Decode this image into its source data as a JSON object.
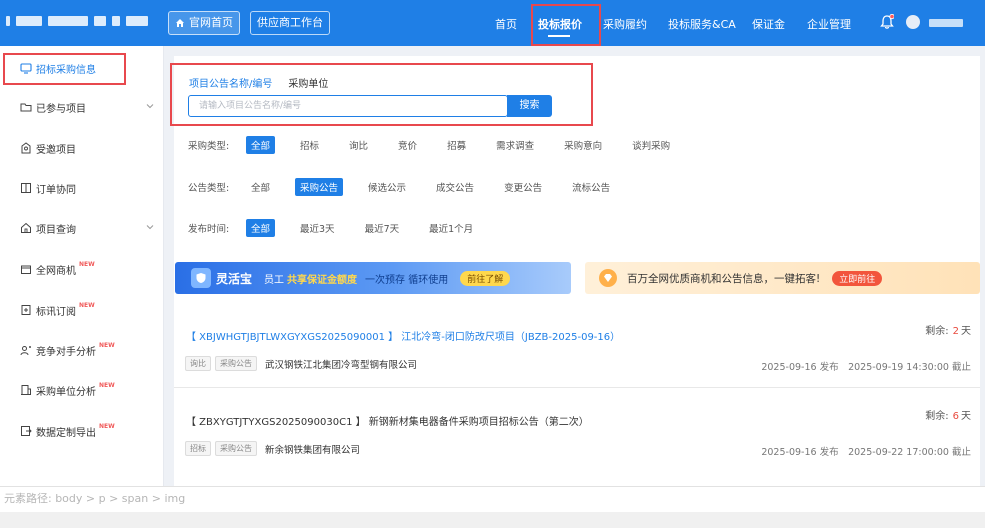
{
  "header": {
    "home_label": "官网首页",
    "supplier_label": "供应商工作台",
    "nav": [
      {
        "label": "首页"
      },
      {
        "label": "投标报价"
      },
      {
        "label": "采购履约"
      },
      {
        "label": "投标服务&CA"
      },
      {
        "label": "保证金"
      },
      {
        "label": "企业管理"
      }
    ],
    "accent_color": "#1f7fe6",
    "highlight_color": "#e8484d"
  },
  "sidebar": {
    "items": [
      {
        "label": "招标采购信息",
        "icon": "monitor-icon"
      },
      {
        "label": "已参与项目",
        "icon": "folder-icon"
      },
      {
        "label": "受邀项目",
        "icon": "invite-icon"
      },
      {
        "label": "订单协同",
        "icon": "book-icon"
      },
      {
        "label": "项目查询",
        "icon": "house-icon"
      },
      {
        "label": "全网商机",
        "icon": "shop-icon",
        "badge": "NEW"
      },
      {
        "label": "标讯订阅",
        "icon": "subscribe-icon",
        "badge": "NEW"
      },
      {
        "label": "竞争对手分析",
        "icon": "compete-icon",
        "badge": "NEW"
      },
      {
        "label": "采购单位分析",
        "icon": "building-icon",
        "badge": "NEW"
      },
      {
        "label": "数据定制导出",
        "icon": "export-icon",
        "badge": "NEW"
      }
    ]
  },
  "search": {
    "tabs": [
      {
        "label": "项目公告名称/编号"
      },
      {
        "label": "采购单位"
      }
    ],
    "placeholder": "请输入项目公告名称/编号",
    "button_label": "搜索"
  },
  "filters": {
    "purchase_type": {
      "label": "采购类型:",
      "options": [
        "全部",
        "招标",
        "询比",
        "竞价",
        "招募",
        "需求调查",
        "采购意向",
        "谈判采购"
      ]
    },
    "notice_type": {
      "label": "公告类型:",
      "options": [
        "全部",
        "采购公告",
        "候选公示",
        "成交公告",
        "变更公告",
        "流标公告"
      ]
    },
    "publish_time": {
      "label": "发布时间:",
      "options": [
        "全部",
        "最近3天",
        "最近7天",
        "最近1个月"
      ]
    }
  },
  "banners": {
    "left": {
      "title": "灵活宝",
      "text1": "员工",
      "highlight": "共享保证金额度",
      "text2": "一次预存 循环使用",
      "button": "前往了解"
    },
    "right": {
      "text": "百万全网优质商机和公告信息，一键拓客!",
      "button": "立即前往"
    }
  },
  "results": [
    {
      "title": "【 XBJWHGTJBJTLWXGYXGS2025090001 】 江北冷弯-闭口防改尺项目（JBZB-2025-09-16）",
      "remain_label": "剩余:",
      "remain_num": "2",
      "remain_unit": "天",
      "tag1": "询比",
      "tag2": "采购公告",
      "company": "武汉钢铁江北集团冷弯型钢有限公司",
      "dates": "2025-09-16 发布　2025-09-19 14:30:00 截止"
    },
    {
      "title": "【 ZBXYGTJTYXGS2025090030C1 】 新钢新材集电器备件采购项目招标公告（第二次）",
      "remain_label": "剩余:",
      "remain_num": "6",
      "remain_unit": "天",
      "tag1": "招标",
      "tag2": "采购公告",
      "company": "新余钢铁集团有限公司",
      "dates": "2025-09-16 发布　2025-09-22 17:00:00 截止"
    }
  ],
  "statusbar": {
    "text": "元素路径: body > p > span > img"
  }
}
